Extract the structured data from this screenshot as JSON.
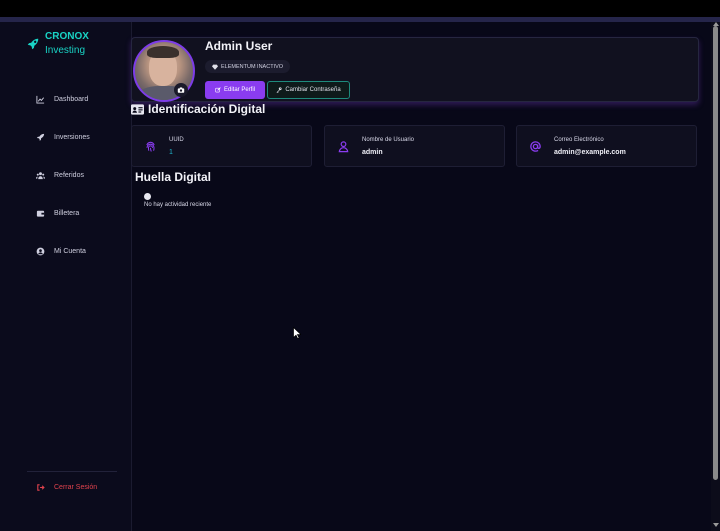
{
  "brand": {
    "line1": "CRONOX",
    "line2": "Investing",
    "accent": "#19d3c5"
  },
  "sidebar": {
    "items": [
      {
        "label": "Dashboard",
        "icon": "chart-line-icon"
      },
      {
        "label": "Inversiones",
        "icon": "rocket-icon"
      },
      {
        "label": "Referidos",
        "icon": "users-icon"
      },
      {
        "label": "Billetera",
        "icon": "wallet-icon"
      },
      {
        "label": "Mi Cuenta",
        "icon": "user-circle-icon"
      }
    ],
    "logout_label": "Cerrar Sesión"
  },
  "profile": {
    "name": "Admin User",
    "status": "ELEMENTUM INACTIVO",
    "edit_label": "Editar Perfil",
    "change_password_label": "Cambiar Contraseña",
    "primary_color": "#8a3cf0"
  },
  "identity": {
    "title": "Identificación Digital",
    "cards": [
      {
        "label": "UUID",
        "value": "1",
        "icon": "fingerprint-icon"
      },
      {
        "label": "Nombre de Usuario",
        "value": "admin",
        "icon": "user-icon"
      },
      {
        "label": "Correo Electrónico",
        "value": "admin@example.com",
        "icon": "at-sign-icon"
      }
    ]
  },
  "footprint": {
    "title": "Huella Digital",
    "empty_text": "No hay actividad reciente"
  }
}
